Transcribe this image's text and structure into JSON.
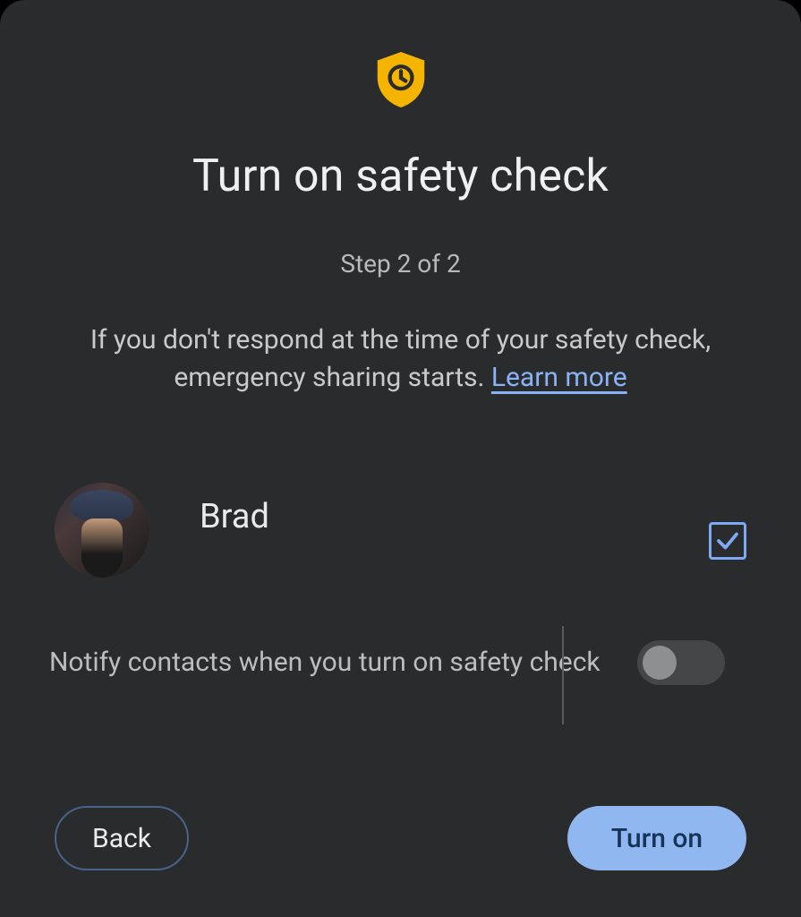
{
  "icon": "shield-clock-icon",
  "title": "Turn on safety check",
  "step": "Step 2 of 2",
  "description_text": "If you don't respond at the time of your safety check, emergency sharing starts. ",
  "learn_more": "Learn more",
  "contacts": [
    {
      "name": "Brad",
      "checked": true
    }
  ],
  "notify_label": "Notify contacts when you turn on safety check",
  "notify_enabled": false,
  "buttons": {
    "back": "Back",
    "turn_on": "Turn on"
  },
  "colors": {
    "accent": "#f5b400",
    "link": "#8ab3f5",
    "primary_btn": "#91b7f0"
  }
}
